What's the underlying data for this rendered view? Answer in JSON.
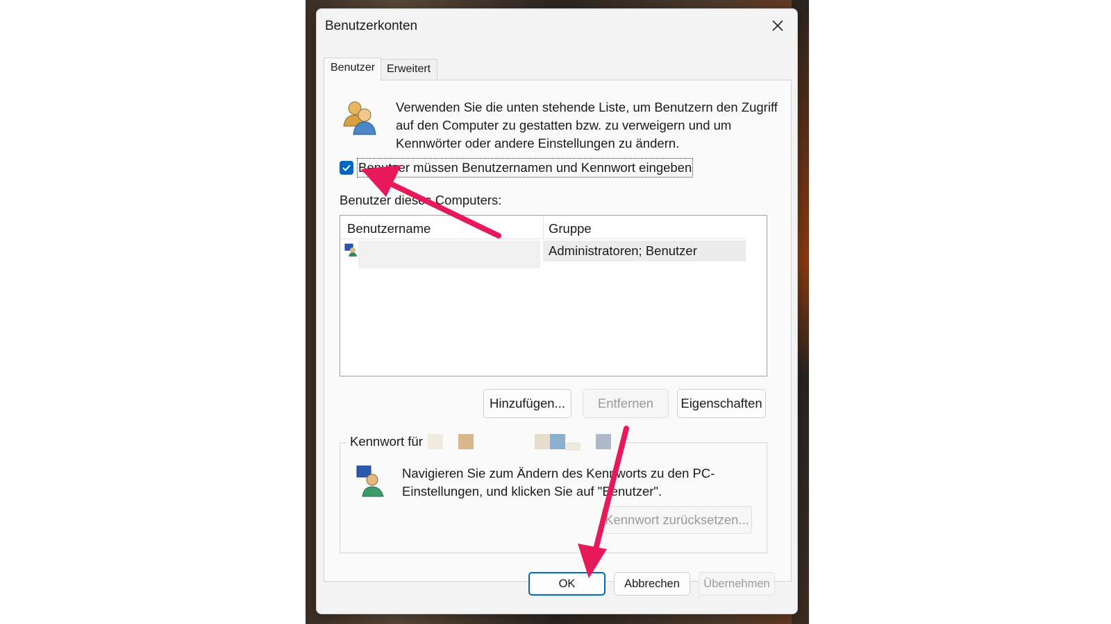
{
  "dialog": {
    "title": "Benutzerkonten",
    "close_icon": "close-icon"
  },
  "tabs": [
    {
      "label": "Benutzer",
      "active": true
    },
    {
      "label": "Erweitert",
      "active": false
    }
  ],
  "intro": {
    "text": "Verwenden Sie die unten stehende Liste, um Benutzern den Zugriff auf den Computer zu gestatten bzw. zu verweigern und um Kennwörter oder andere Einstellungen zu ändern.",
    "icon": "users-icon"
  },
  "require_login": {
    "checked": true,
    "label": "Benutzer müssen Benutzernamen und Kennwort eingeben"
  },
  "users_list": {
    "caption": "Benutzer dieses Computers:",
    "columns": [
      "Benutzername",
      "Gruppe"
    ],
    "rows": [
      {
        "name": "",
        "group": "Administratoren; Benutzer",
        "icon": "user-account-icon"
      }
    ]
  },
  "list_buttons": {
    "add": "Hinzufügen...",
    "remove": "Entfernen",
    "properties": "Eigenschaften"
  },
  "password_group": {
    "legend": "Kennwort für",
    "text": "Navigieren Sie zum Ändern des Kennworts zu den PC-Einstellungen, und klicken Sie auf \"Benutzer\".",
    "reset_button": "Kennwort zurücksetzen...",
    "icon": "user-password-icon"
  },
  "footer_buttons": {
    "ok": "OK",
    "cancel": "Abbrechen",
    "apply": "Übernehmen"
  },
  "colors": {
    "accent": "#0067c0",
    "annotation_arrow": "#e8195a"
  }
}
